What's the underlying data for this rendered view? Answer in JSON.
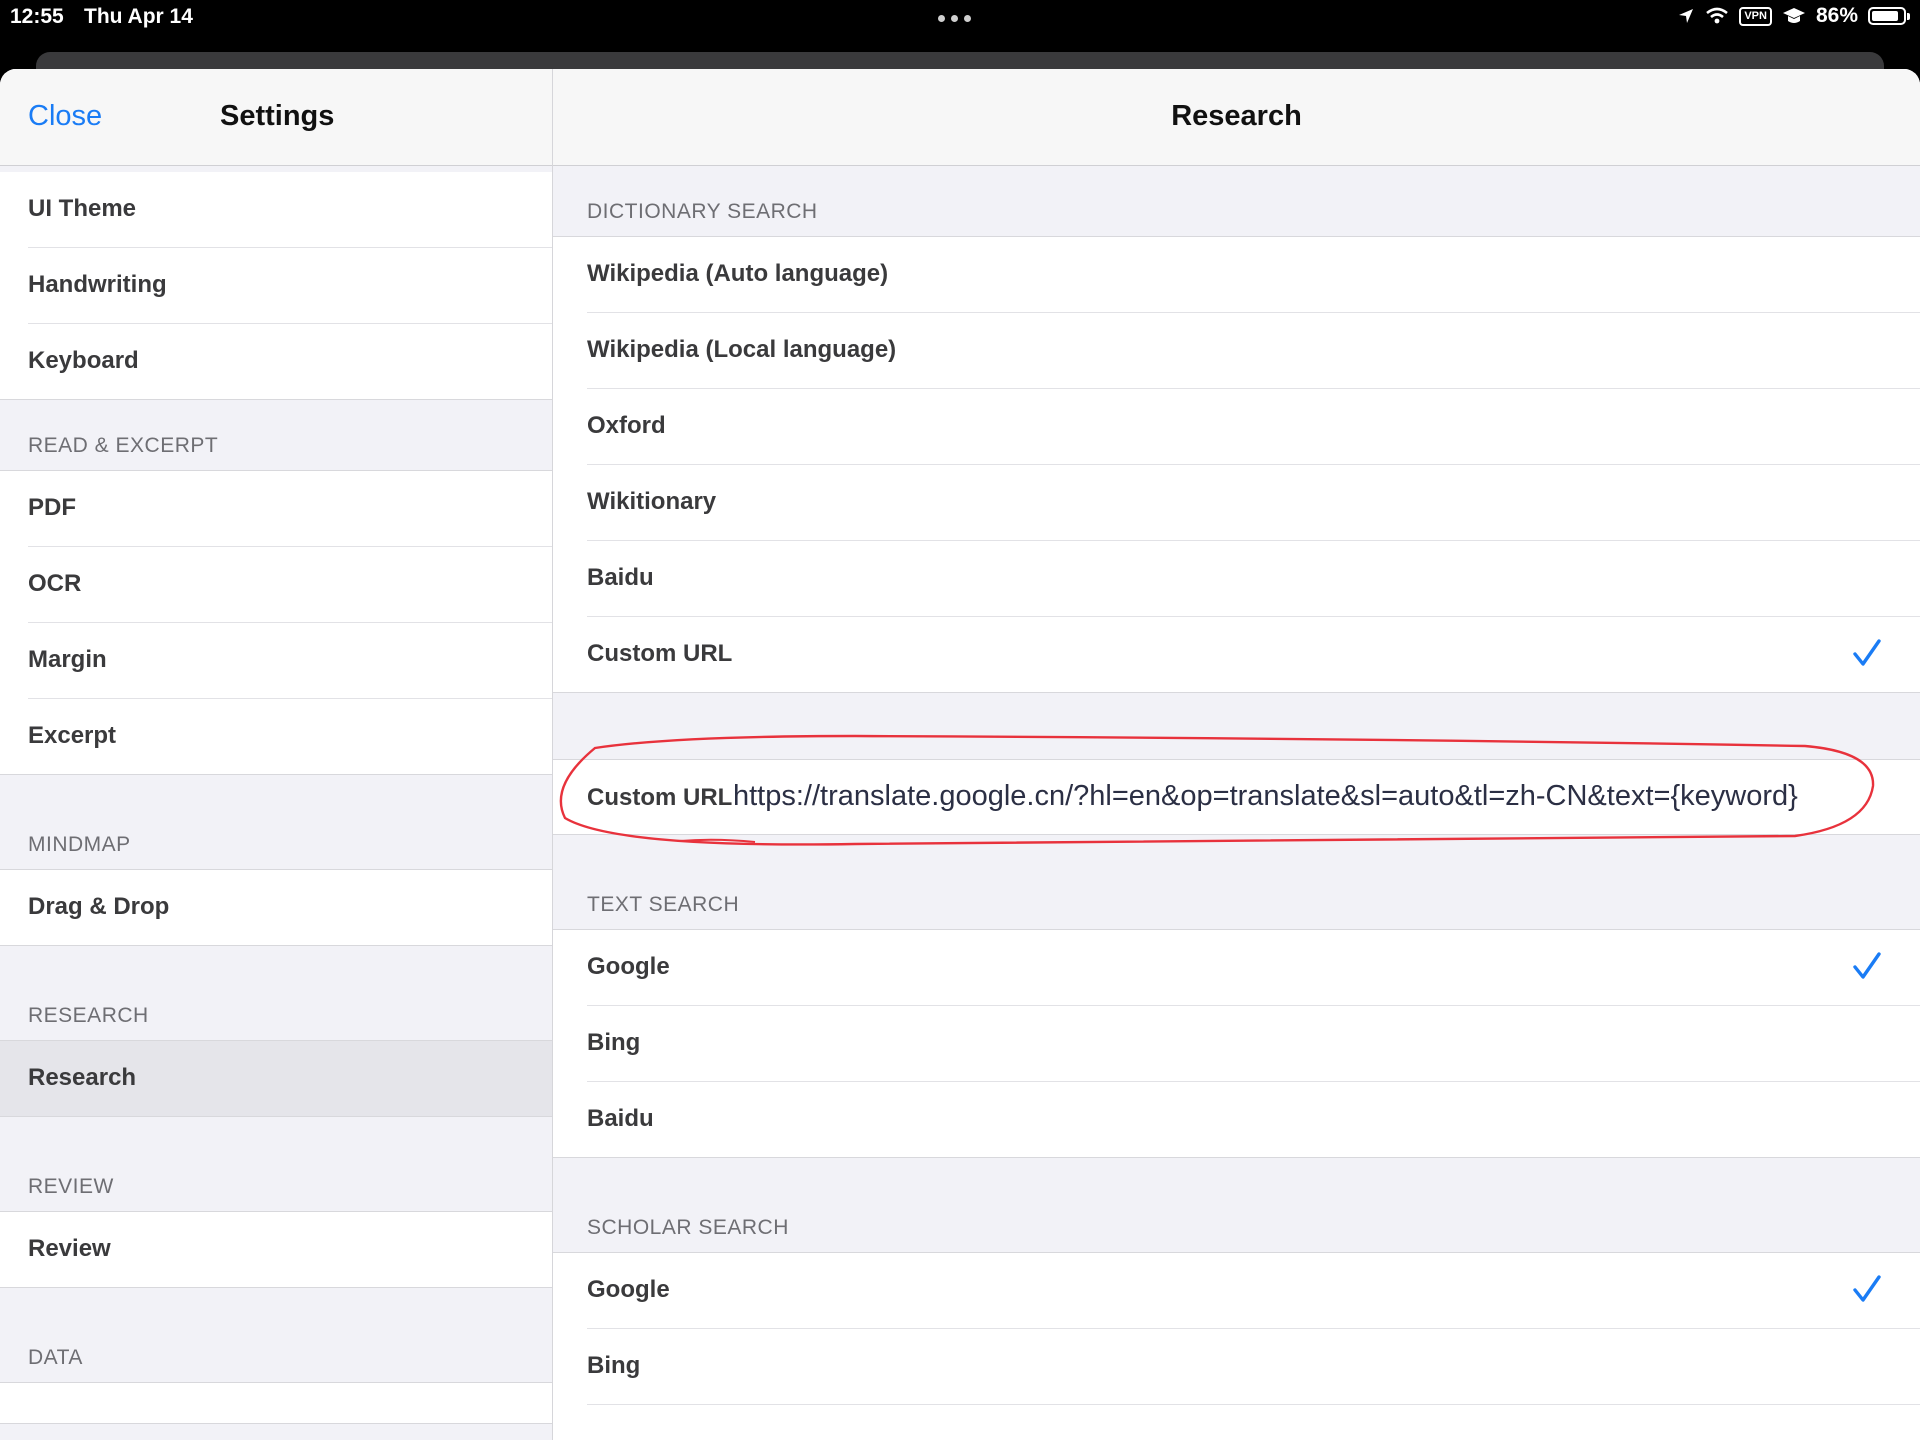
{
  "status": {
    "time": "12:55",
    "date": "Thu Apr 14",
    "vpn": "VPN",
    "battery_pct": "86%",
    "battery_level": 0.86
  },
  "master": {
    "close": "Close",
    "title": "Settings",
    "top_items": [
      "UI Theme",
      "Handwriting",
      "Keyboard"
    ],
    "sections": [
      {
        "header": "READ & EXCERPT",
        "items": [
          "PDF",
          "OCR",
          "Margin",
          "Excerpt"
        ]
      },
      {
        "header": "MINDMAP",
        "items": [
          "Drag & Drop"
        ]
      },
      {
        "header": "RESEARCH",
        "items": [
          "Research"
        ]
      },
      {
        "header": "REVIEW",
        "items": [
          "Review"
        ]
      },
      {
        "header": "DATA",
        "items": []
      }
    ],
    "selected_item": "Research"
  },
  "detail": {
    "title": "Research",
    "dictionary": {
      "header": "DICTIONARY SEARCH",
      "items": [
        "Wikipedia (Auto language)",
        "Wikipedia (Local language)",
        "Oxford",
        "Wikitionary",
        "Baidu",
        "Custom URL"
      ],
      "checked": "Custom URL"
    },
    "custom_url": {
      "label": "Custom URL",
      "value": "https://translate.google.cn/?hl=en&op=translate&sl=auto&tl=zh-CN&text={keyword}"
    },
    "text_search": {
      "header": "TEXT SEARCH",
      "items": [
        "Google",
        "Bing",
        "Baidu"
      ],
      "checked": "Google"
    },
    "scholar_search": {
      "header": "SCHOLAR SEARCH",
      "items": [
        "Google",
        "Bing"
      ],
      "checked": "Google"
    }
  },
  "colors": {
    "accent": "#1a7cf5",
    "annotation": "#e8323c"
  }
}
